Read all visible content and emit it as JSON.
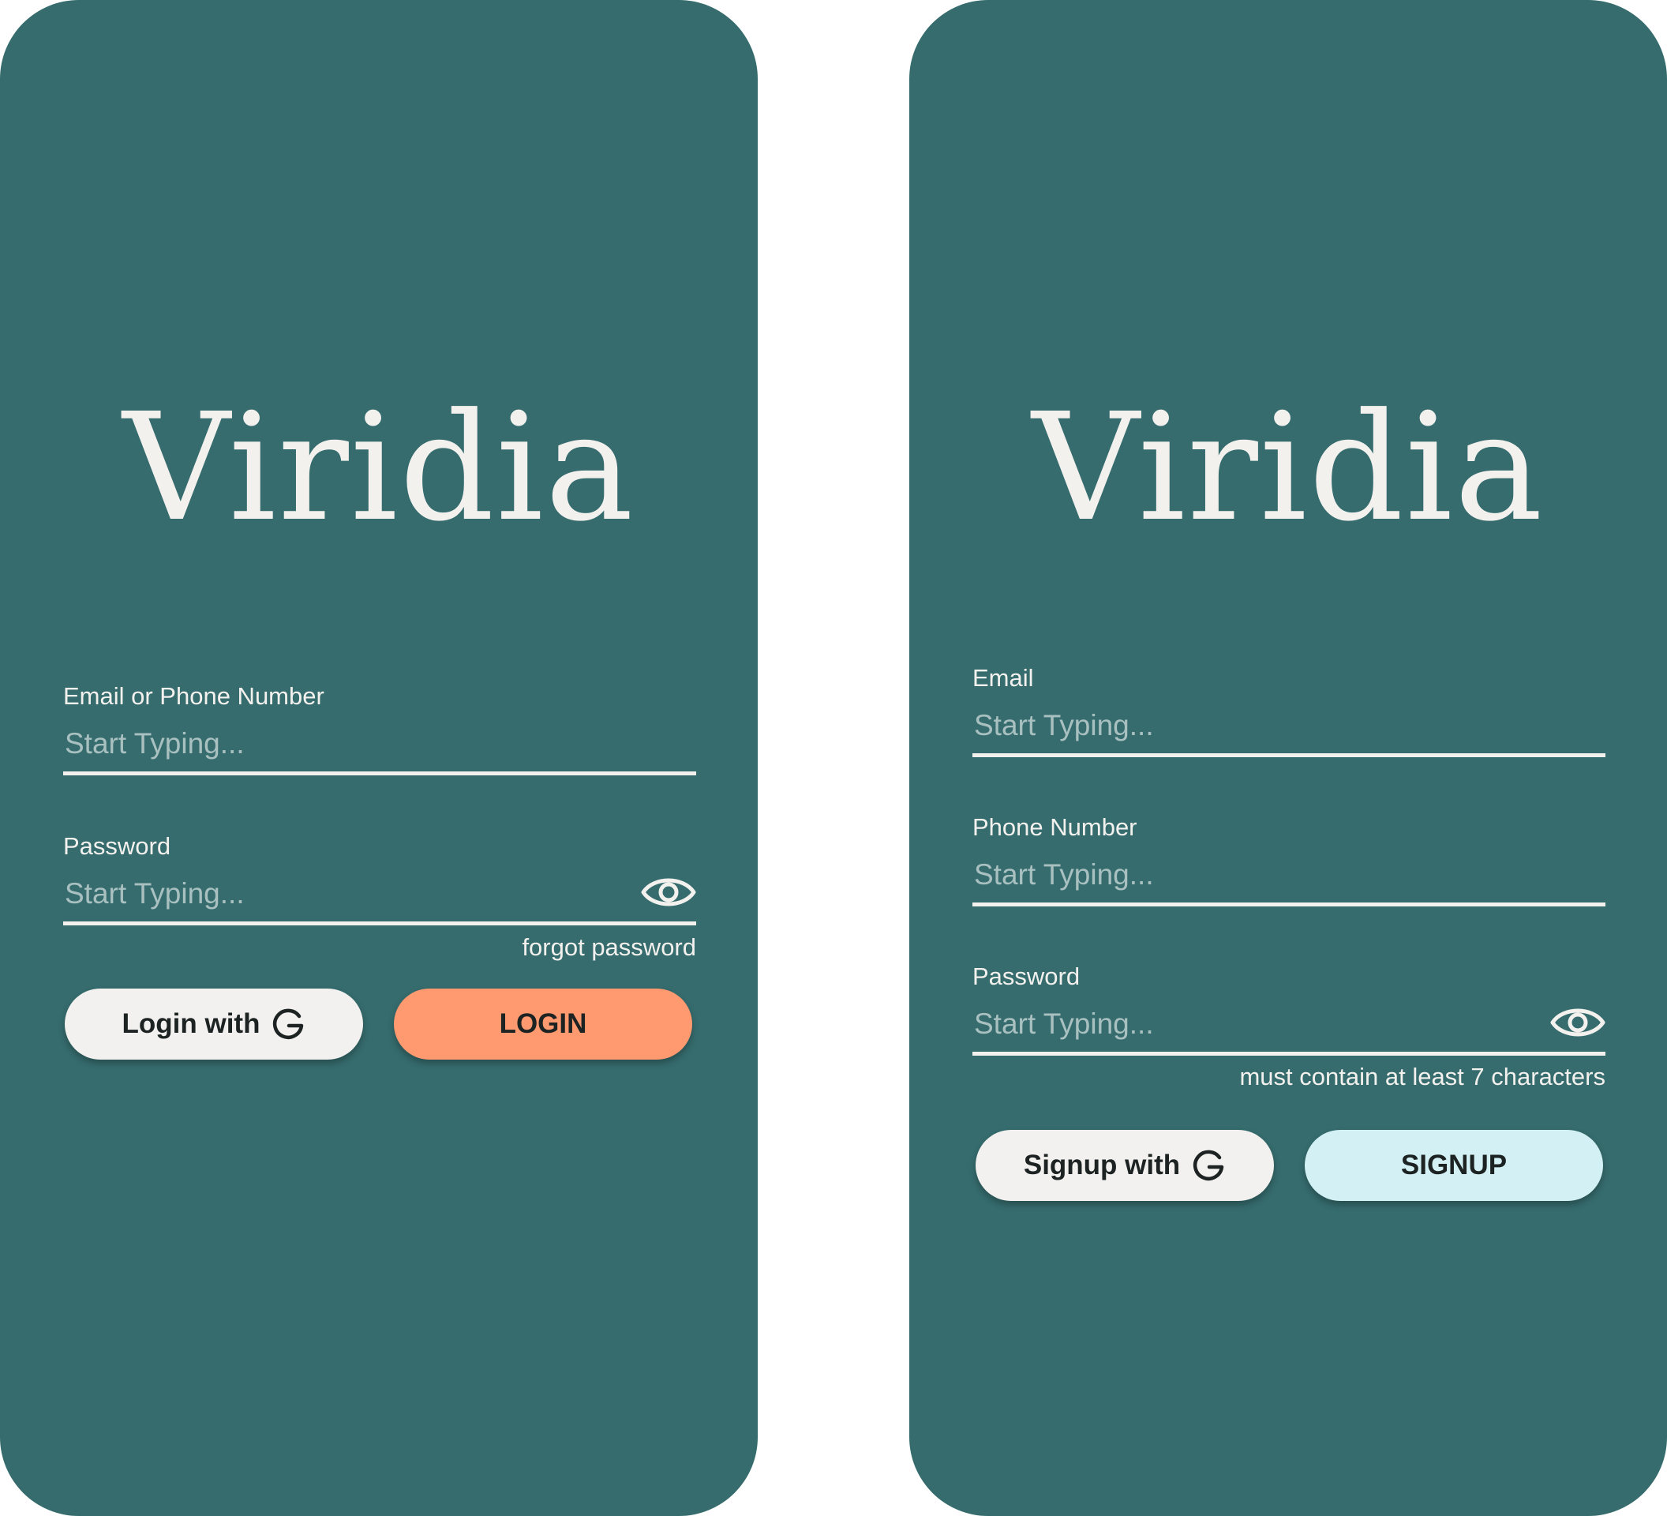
{
  "colors": {
    "panel": "#366c6e",
    "text_light": "#f3f1ee",
    "placeholder": "#a9c0c0",
    "login_accent": "#ff996f",
    "signup_accent": "#d3f1f5",
    "button_light": "#f2f1ef",
    "button_text": "#1c2322"
  },
  "login": {
    "brand": "Viridia",
    "fields": [
      {
        "label": "Email or Phone Number",
        "placeholder": "Start Typing..."
      },
      {
        "label": "Password",
        "placeholder": "Start Typing...",
        "icon": "eye-icon"
      }
    ],
    "forgot_link": "forgot password",
    "google_button": {
      "label": "Login with",
      "icon": "google-g-icon"
    },
    "submit_button": "LOGIN"
  },
  "signup": {
    "brand": "Viridia",
    "fields": [
      {
        "label": "Email",
        "placeholder": "Start Typing..."
      },
      {
        "label": "Phone Number",
        "placeholder": "Start Typing..."
      },
      {
        "label": "Password",
        "placeholder": "Start Typing...",
        "icon": "eye-icon"
      }
    ],
    "password_hint": "must contain at least 7 characters",
    "google_button": {
      "label": "Signup with",
      "icon": "google-g-icon"
    },
    "submit_button": "SIGNUP"
  }
}
